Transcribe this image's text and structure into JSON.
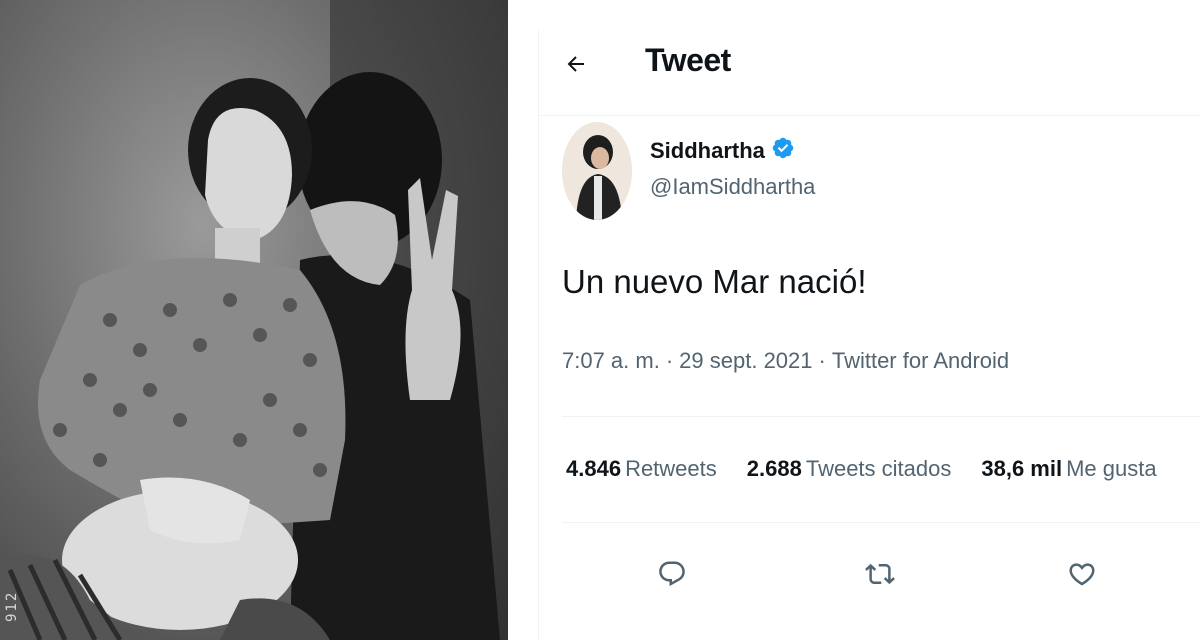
{
  "header": {
    "title": "Tweet"
  },
  "author": {
    "name": "Siddhartha",
    "handle": "@IamSiddhartha",
    "verified": true
  },
  "tweet": {
    "text": "Un nuevo Mar nació!",
    "time": "7:07 a. m.",
    "date": "29 sept. 2021",
    "source": "Twitter for Android",
    "separator": "·"
  },
  "stats": {
    "retweets_count": "4.846",
    "retweets_label": "Retweets",
    "quotes_count": "2.688",
    "quotes_label": "Tweets citados",
    "likes_count": "38,6 mil",
    "likes_label": "Me gusta"
  },
  "photo": {
    "watermark": "912"
  },
  "colors": {
    "text_primary": "#0f1419",
    "text_secondary": "#536471",
    "verified_blue": "#1d9bf0",
    "border": "#eff3f4"
  },
  "icons": {
    "back": "arrow-left-icon",
    "verified": "verified-badge-icon",
    "reply": "reply-icon",
    "retweet": "retweet-icon",
    "like": "heart-icon"
  }
}
